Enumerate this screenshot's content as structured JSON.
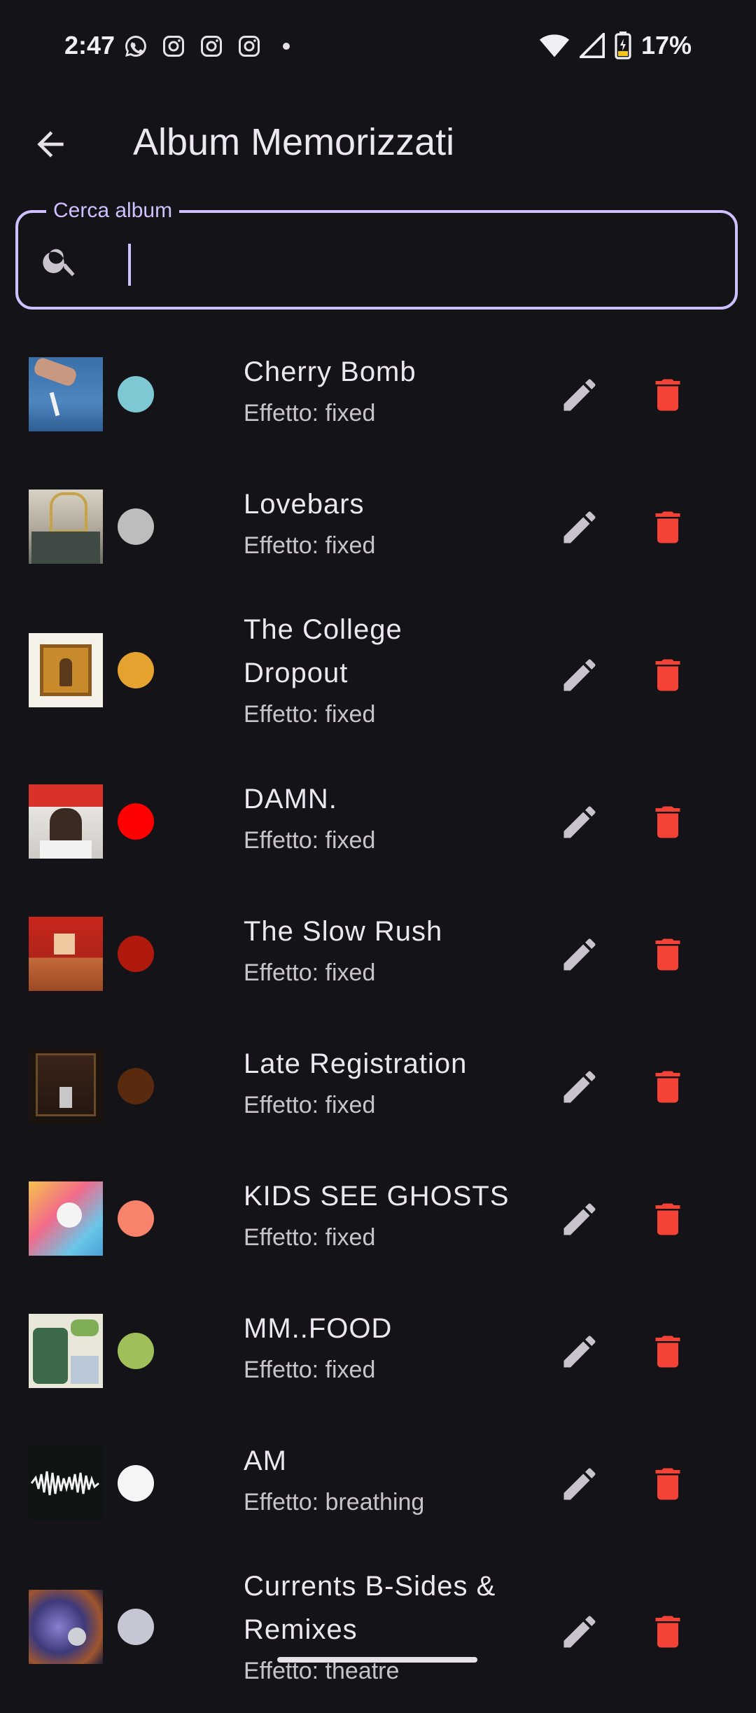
{
  "status_bar": {
    "time": "2:47",
    "notification_icons": [
      "whatsapp-icon",
      "instagram-icon",
      "instagram-icon",
      "instagram-icon",
      "more-dot-icon"
    ],
    "battery": "17%"
  },
  "app_bar": {
    "title": "Album Memorizzati",
    "back_icon": "arrow-back-icon"
  },
  "search": {
    "label": "Cerca album",
    "value": "",
    "placeholder": ""
  },
  "colors": {
    "accent": "#cfc0ff",
    "delete": "#f44336",
    "edit": "#c8c3cc",
    "background": "#141318"
  },
  "albums": [
    {
      "name": "Cherry Bomb",
      "effect": "Effetto: fixed",
      "color": "#7ec8d3"
    },
    {
      "name": "Lovebars",
      "effect": "Effetto: fixed",
      "color": "#bdbdbd"
    },
    {
      "name": "The College Dropout",
      "effect": "Effetto: fixed",
      "color": "#e6a22e"
    },
    {
      "name": "DAMN.",
      "effect": "Effetto: fixed",
      "color": "#ff0000"
    },
    {
      "name": "The Slow Rush",
      "effect": "Effetto: fixed",
      "color": "#b01a0e"
    },
    {
      "name": "Late Registration",
      "effect": "Effetto: fixed",
      "color": "#5a2a0e"
    },
    {
      "name": "KIDS SEE GHOSTS",
      "effect": "Effetto: fixed",
      "color": "#f7836b"
    },
    {
      "name": "MM..FOOD",
      "effect": "Effetto: fixed",
      "color": "#9fbf5a"
    },
    {
      "name": "AM",
      "effect": "Effetto: breathing",
      "color": "#f5f5f5"
    },
    {
      "name": "Currents B-Sides & Remixes",
      "effect": "Effetto: theatre",
      "color": "#c5c7d4"
    }
  ]
}
